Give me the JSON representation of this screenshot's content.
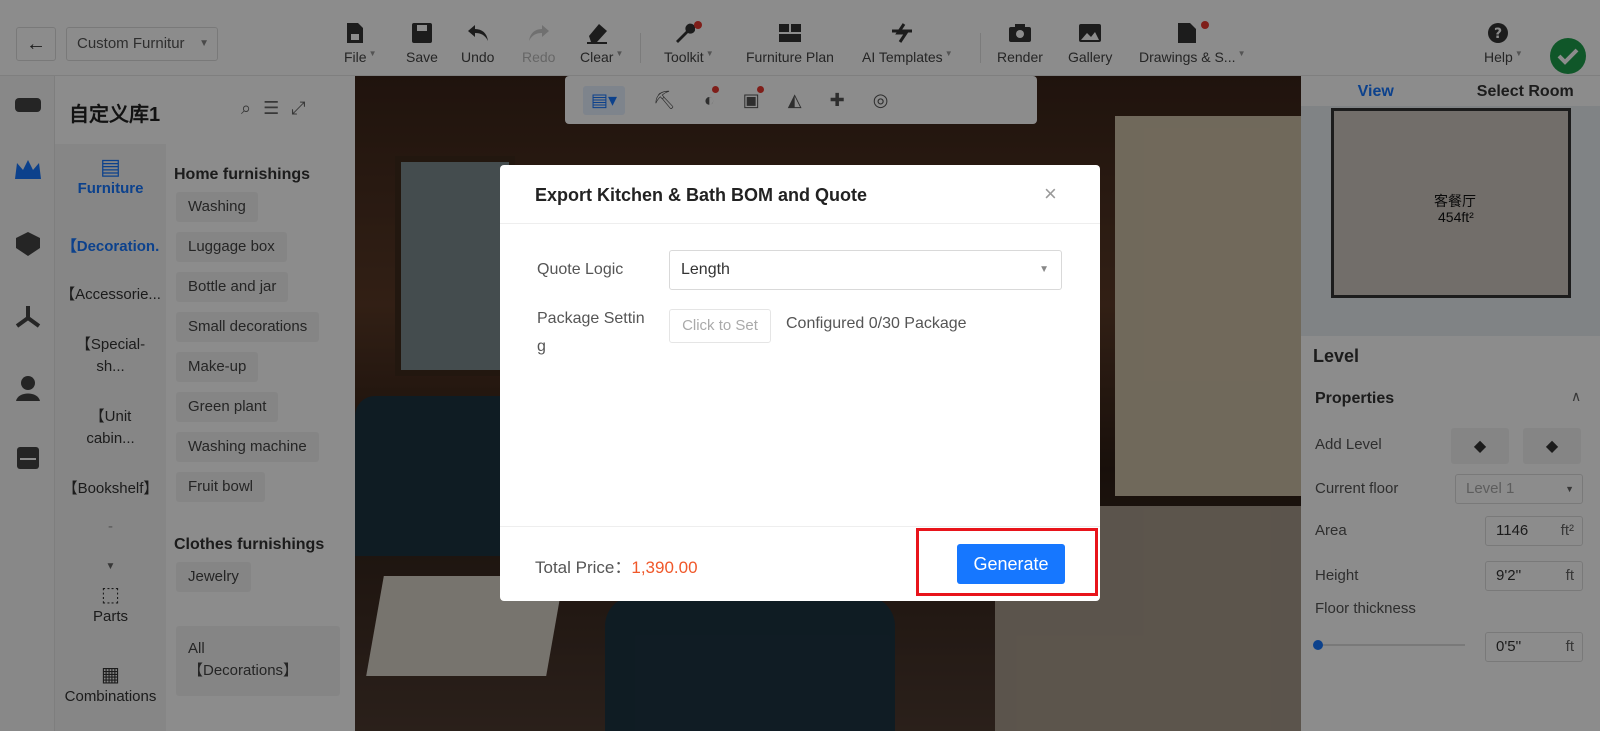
{
  "toolbar": {
    "library_select": "Custom Furnitur",
    "tools": {
      "file": "File",
      "save": "Save",
      "undo": "Undo",
      "redo": "Redo",
      "clear": "Clear",
      "toolkit": "Toolkit",
      "furniture_plan": "Furniture Plan",
      "ai_templates": "AI Templates",
      "render": "Render",
      "gallery": "Gallery",
      "drawings": "Drawings & S...",
      "help": "Help"
    }
  },
  "library": {
    "title": "自定义库1",
    "furniture_tab": "Furniture",
    "categories": [
      "【Decoration.",
      "【Accessorie...",
      "【Special-sh...",
      "【Unit cabin...",
      "【Bookshelf】",
      "-"
    ],
    "bottom": {
      "parts": "Parts",
      "combinations": "Combinations"
    },
    "home_heading": "Home furnishings",
    "home_items": [
      "Washing",
      "Luggage box",
      "Bottle and jar",
      "Small decorations",
      "Make-up",
      "Green plant",
      "Washing machine",
      "Fruit bowl"
    ],
    "clothes_heading": "Clothes furnishings",
    "clothes_items": [
      "Jewelry"
    ],
    "all_label_1": "All",
    "all_label_2": "【Decorations】"
  },
  "right_panel": {
    "tab_view": "View",
    "tab_select_room": "Select Room",
    "minimap_room": "客餐厅",
    "minimap_area": "454ft²",
    "level_title": "Level",
    "properties_title": "Properties",
    "add_level": "Add Level",
    "current_floor_label": "Current floor",
    "current_floor_value": "Level 1",
    "area_label": "Area",
    "area_value": "1146",
    "area_unit": "ft²",
    "height_label": "Height",
    "height_value": "9'2''",
    "height_unit": "ft",
    "floor_thickness_label": "Floor thickness",
    "floor_thickness_value": "0'5''",
    "floor_thickness_unit": "ft"
  },
  "modal": {
    "title": "Export Kitchen & Bath BOM and Quote",
    "quote_logic_label": "Quote Logic",
    "quote_logic_value": "Length",
    "package_setting_label_1": "Package Settin",
    "package_setting_label_2": "g",
    "click_to_set": "Click to Set",
    "configured": "Configured 0/30 Package",
    "total_price_label": "Total Price：",
    "total_price_value": "1,390.00",
    "generate_label": "Generate"
  },
  "colors": {
    "accent": "#1677ff",
    "price": "#f0582a",
    "highlight": "#e8141b",
    "success": "#1e9f4b"
  }
}
